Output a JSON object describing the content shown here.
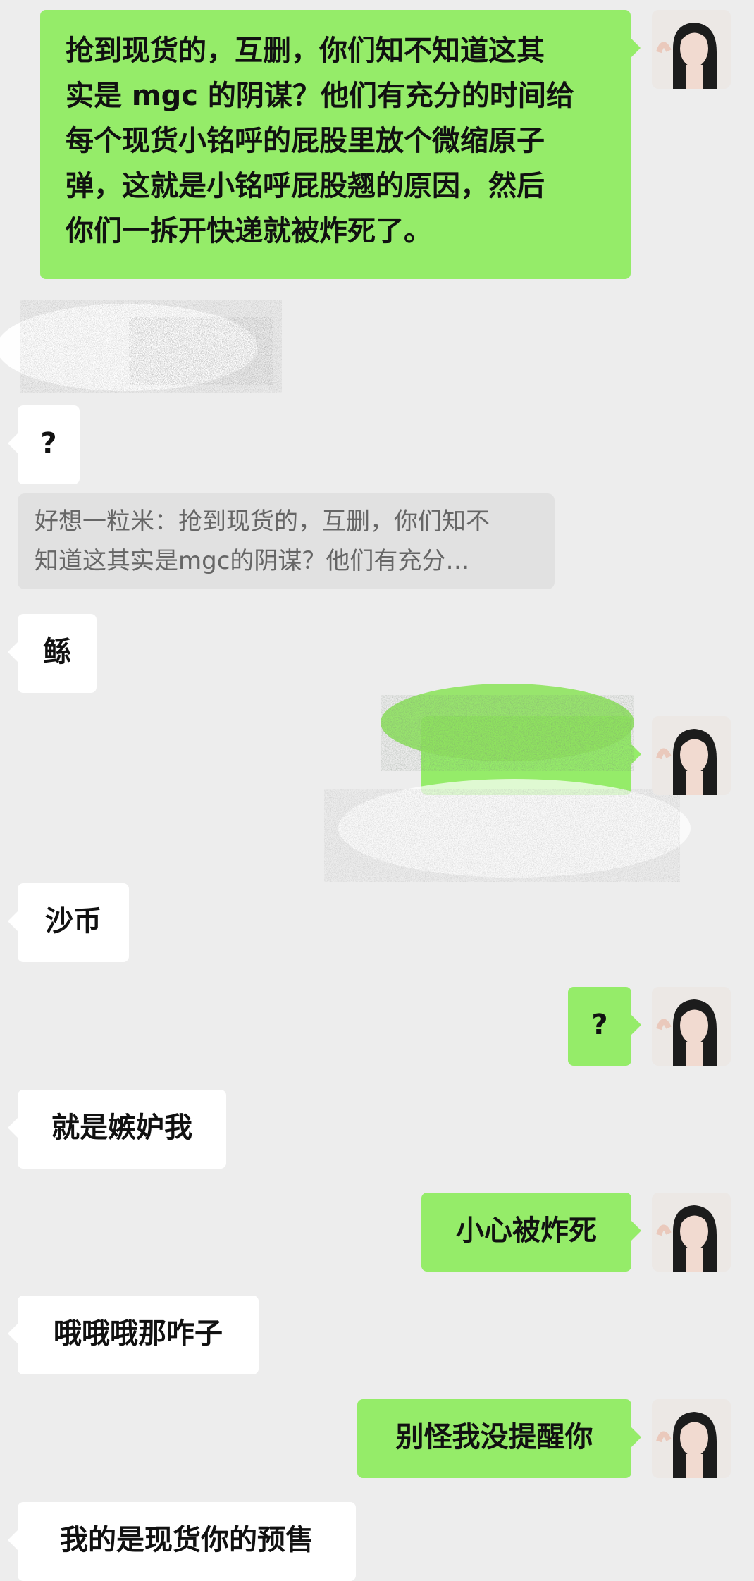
{
  "colors": {
    "background": "#ededed",
    "outgoing_bubble": "#95ec69",
    "incoming_bubble": "#ffffff",
    "quote_block": "#e1e1e1"
  },
  "messages": {
    "m1_lines": [
      "抢到现货的，互删，你们知不知道这其",
      "实是 mgc 的阴谋？他们有充分的时间给",
      "每个现货小铭呼的屁股里放个微缩原子",
      "弹，这就是小铭呼屁股翘的原因，然后",
      "你们一拆开快递就被炸死了。"
    ],
    "m3": "?",
    "quote": {
      "line1": "好想一粒米：抢到现货的，互删，你们知不",
      "line2": "知道这其实是mgc的阴谋？他们有充分…"
    },
    "m4": "鲧",
    "m6": "沙币",
    "m7": "?",
    "m8": "就是嫉妒我",
    "m9": "小心被炸死",
    "m10": "哦哦哦那咋子",
    "m11": "别怪我没提醒你",
    "m12": "我的是现货你的预售"
  },
  "icons": {
    "avatar": "user-avatar-photo",
    "redaction": "scribble-redaction"
  }
}
